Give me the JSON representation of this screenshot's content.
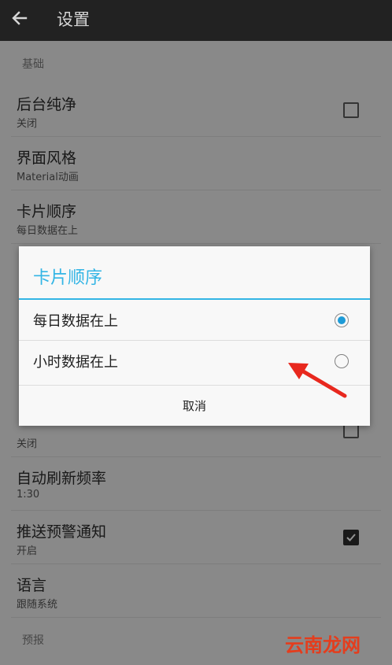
{
  "toolbar": {
    "title": "设置"
  },
  "sections": {
    "basic": "基础",
    "forecast": "预报"
  },
  "prefs": [
    {
      "title": "后台纯净",
      "summary": "关闭",
      "checkbox": "unchecked"
    },
    {
      "title": "界面风格",
      "summary": "Material动画"
    },
    {
      "title": "卡片顺序",
      "summary": "每日数据在上"
    },
    {
      "title": "",
      "summary": "关闭",
      "checkbox": "unchecked"
    },
    {
      "title": "自动刷新频率",
      "summary": "1:30"
    },
    {
      "title": "推送预警通知",
      "summary": "开启",
      "checkbox": "checked"
    },
    {
      "title": "语言",
      "summary": "跟随系统"
    }
  ],
  "dialog": {
    "title": "卡片顺序",
    "options": [
      {
        "label": "每日数据在上",
        "selected": true
      },
      {
        "label": "小时数据在上",
        "selected": false
      }
    ],
    "cancel_label": "取消"
  },
  "watermark": "云南龙网",
  "colors": {
    "accent": "#33b5e5",
    "toolbar": "#222222",
    "arrow": "#e8281e"
  }
}
